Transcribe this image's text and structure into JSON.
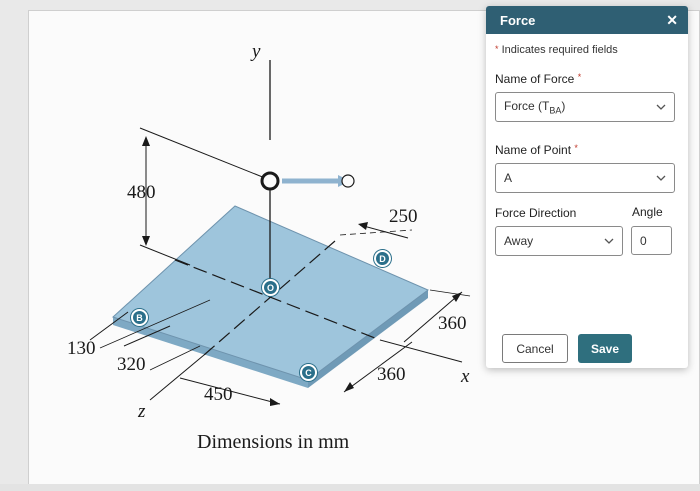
{
  "figure": {
    "axes": {
      "y": "y",
      "x": "x",
      "z": "z"
    },
    "dimensions": {
      "d480": "480",
      "d250": "250",
      "d360_right": "360",
      "d360_bottom": "360",
      "d130": "130",
      "d320": "320",
      "d450": "450"
    },
    "points": {
      "B": "B",
      "D": "D",
      "O": "O",
      "C": "C"
    },
    "caption": "Dimensions in mm",
    "colors": {
      "plate": "#9ec5dc",
      "plate_edge": "#6e93ad",
      "badge": "#2b6f8a"
    }
  },
  "panel": {
    "title": "Force",
    "close_icon": "close-icon",
    "required_note": "Indicates required fields",
    "name_of_force_label": "Name of Force",
    "name_of_force_value_main": "Force (T",
    "name_of_force_value_sub": "BA",
    "name_of_force_value_end": ")",
    "name_of_point_label": "Name of Point",
    "name_of_point_value": "A",
    "force_direction_label": "Force Direction",
    "force_direction_value": "Away",
    "angle_label": "Angle",
    "angle_value": "0",
    "cancel_label": "Cancel",
    "save_label": "Save",
    "colors": {
      "header": "#2f5f73",
      "save": "#2f6f7e",
      "required": "#c0392b"
    }
  }
}
